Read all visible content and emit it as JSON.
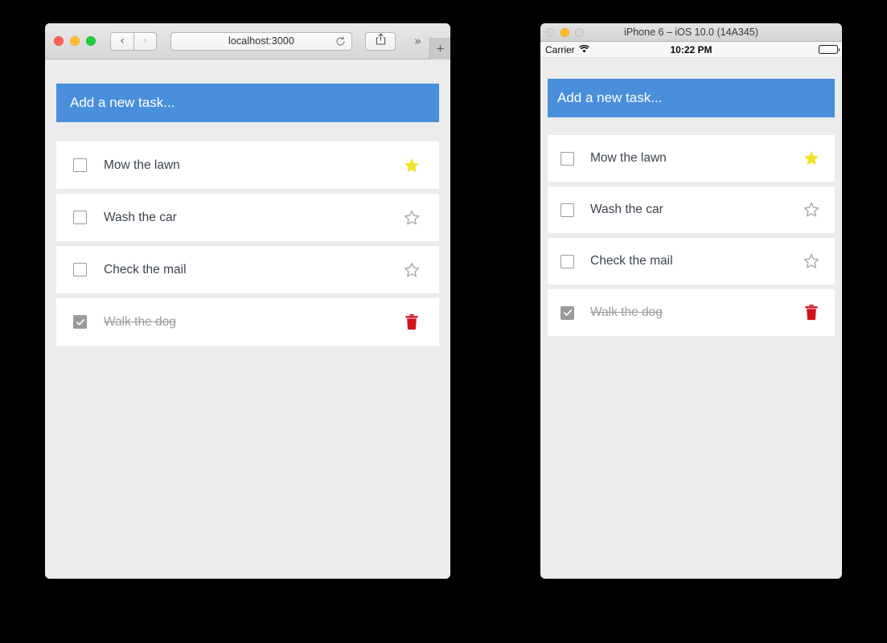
{
  "browser": {
    "traffic_lights": [
      "close",
      "minimize",
      "zoom"
    ],
    "back_label": "‹",
    "forward_label": "›",
    "url": "localhost:3000",
    "reload_icon": "reload-icon",
    "share_icon": "share-icon",
    "overflow_label": "»",
    "new_tab_label": "+"
  },
  "simulator": {
    "title": "iPhone 6 – iOS 10.0 (14A345)",
    "status": {
      "carrier": "Carrier",
      "wifi_icon": "wifi-icon",
      "time": "10:22 PM",
      "battery_icon": "battery-icon"
    }
  },
  "app": {
    "header_placeholder": "Add a new task...",
    "accent_color": "#4a8fdb",
    "star_filled_color": "#f5e124",
    "star_empty_color": "#a8a8a8",
    "trash_color": "#d0141e",
    "tasks": [
      {
        "label": "Mow the lawn",
        "done": false,
        "action": "star-filled-icon"
      },
      {
        "label": "Wash the car",
        "done": false,
        "action": "star-empty-icon"
      },
      {
        "label": "Check the mail",
        "done": false,
        "action": "star-empty-icon"
      },
      {
        "label": "Walk the dog",
        "done": true,
        "action": "trash-icon"
      }
    ]
  }
}
